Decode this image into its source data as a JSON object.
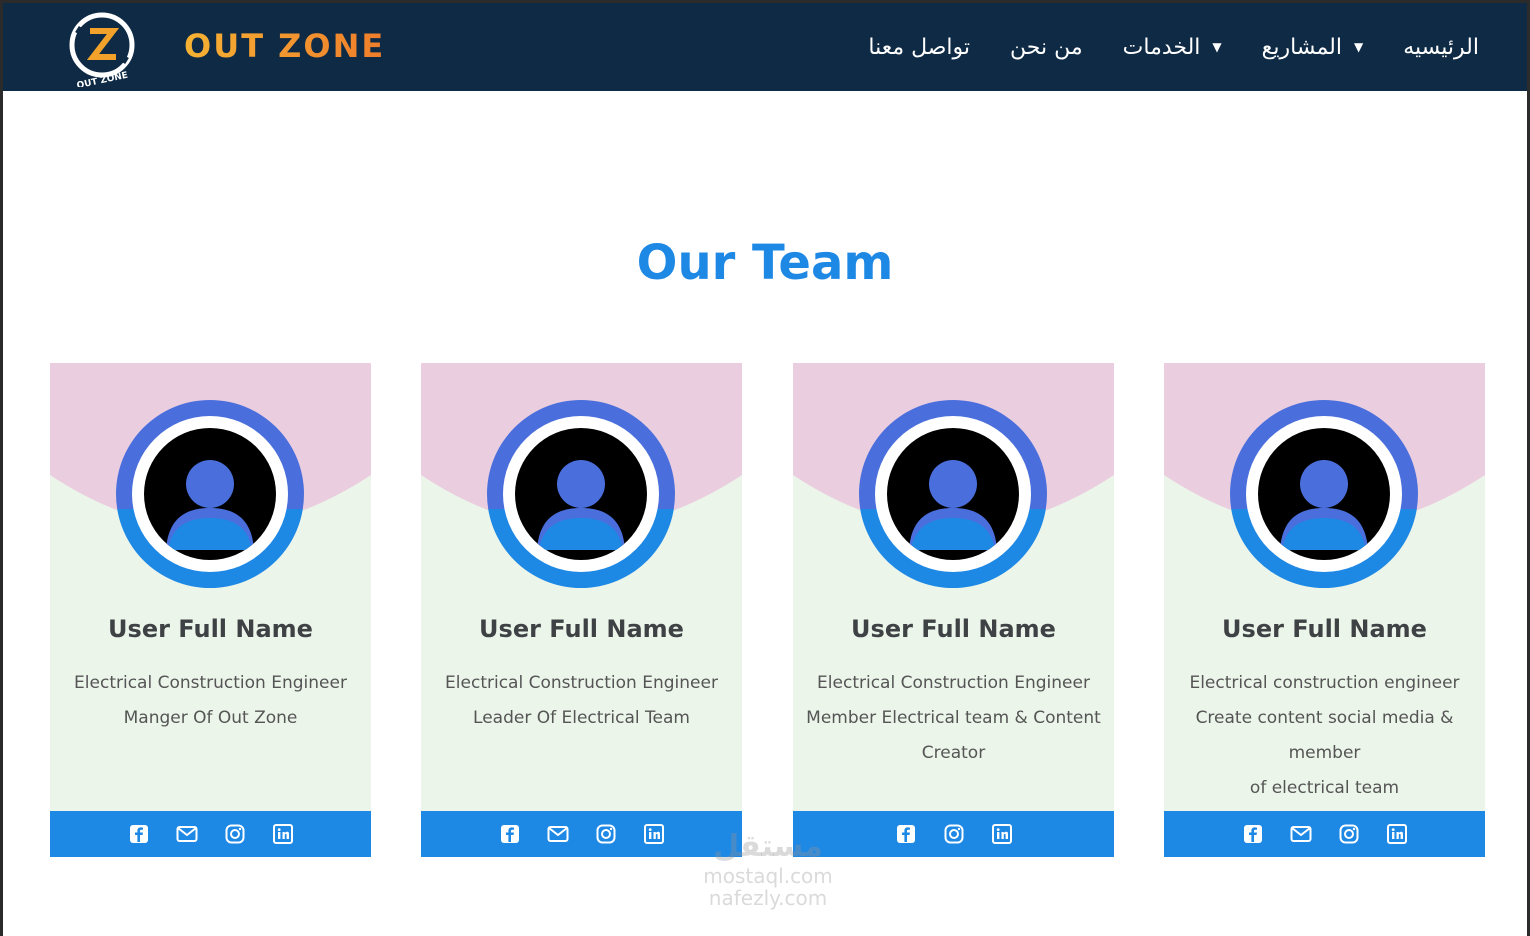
{
  "brand": {
    "name": "OUT ZONE",
    "logo_letter": "Z",
    "logo_caption": "OUT ZONE"
  },
  "nav": {
    "items": [
      {
        "label": "الرئيسيه",
        "dropdown": false
      },
      {
        "label": "المشاريع",
        "dropdown": true
      },
      {
        "label": "الخدمات",
        "dropdown": true
      },
      {
        "label": "من نحن",
        "dropdown": false
      },
      {
        "label": "تواصل معنا",
        "dropdown": false
      }
    ]
  },
  "section": {
    "title": "Our Team"
  },
  "colors": {
    "navbar": "#0e2a45",
    "accent": "#1e88e5",
    "card_top": "#ebcde0",
    "card_body": "#ebf5ea"
  },
  "team": [
    {
      "name": "User Full Name",
      "desc_lines": [
        "Electrical Construction Engineer",
        "Manger Of Out Zone"
      ],
      "social": [
        "facebook-icon",
        "mail-icon",
        "instagram-icon",
        "linkedin-icon"
      ]
    },
    {
      "name": "User Full Name",
      "desc_lines": [
        "Electrical Construction Engineer",
        "Leader Of Electrical Team"
      ],
      "social": [
        "facebook-icon",
        "mail-icon",
        "instagram-icon",
        "linkedin-icon"
      ]
    },
    {
      "name": "User Full Name",
      "desc_lines": [
        "Electrical Construction Engineer",
        "Member Electrical team & Content",
        "Creator"
      ],
      "social": [
        "facebook-icon",
        "instagram-icon",
        "linkedin-icon"
      ]
    },
    {
      "name": "User Full Name",
      "desc_lines": [
        "Electrical construction engineer",
        "Create content social media & member",
        "of electrical team"
      ],
      "social": [
        "facebook-icon",
        "mail-icon",
        "instagram-icon",
        "linkedin-icon"
      ]
    }
  ],
  "watermark": {
    "line1": "مستقل",
    "line2": "mostaql.com",
    "line3": "nafezly.com"
  }
}
